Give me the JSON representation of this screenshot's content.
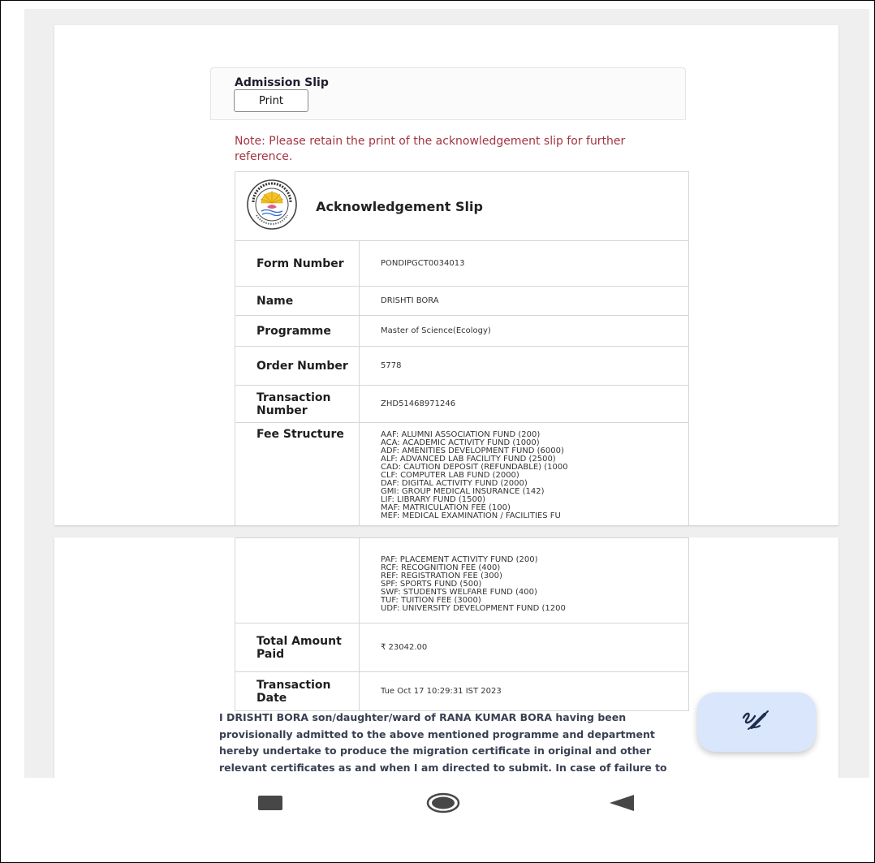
{
  "admission": {
    "title": "Admission Slip",
    "print_label": "Print"
  },
  "note": "Note: Please retain the print of the acknowledgement slip for further reference.",
  "slip": {
    "title": "Acknowledgement Slip",
    "logo_text": "PONDICHERRY UNIVERSITY",
    "rows": [
      {
        "label": "Form Number",
        "value": "PONDIPGCT0034013"
      },
      {
        "label": "Name",
        "value": "DRISHTI BORA"
      },
      {
        "label": "Programme",
        "value": "Master of Science(Ecology)"
      },
      {
        "label": "Order Number",
        "value": "5778"
      },
      {
        "label": "Transaction Number",
        "value": "ZHD51468971246"
      }
    ],
    "fee_label": "Fee Structure",
    "fees_page1": [
      "AAF: ALUMNI ASSOCIATION FUND (200)",
      "ACA: ACADEMIC ACTIVITY FUND (1000)",
      "ADF: AMENITIES DEVELOPMENT FUND (6000)",
      "ALF: ADVANCED LAB FACILITY FUND (2500)",
      "CAD: CAUTION DEPOSIT (REFUNDABLE) (1000",
      "CLF: COMPUTER LAB FUND (2000)",
      "DAF: DIGITAL ACTIVITY FUND (2000)",
      "GMI: GROUP MEDICAL INSURANCE (142)",
      "LIF: LIBRARY FUND (1500)",
      "MAF: MATRICULATION FEE (100)",
      "MEF: MEDICAL EXAMINATION / FACILITIES FU"
    ],
    "fees_page2": [
      "PAF: PLACEMENT ACTIVITY FUND (200)",
      "RCF: RECOGNITION FEE (400)",
      "REF: REGISTRATION FEE (300)",
      "SPF: SPORTS FUND (500)",
      "SWF: STUDENTS WELFARE FUND (400)",
      "TUF: TUITION FEE (3000)",
      "UDF: UNIVERSITY DEVELOPMENT FUND (1200"
    ],
    "total_label": "Total Amount Paid",
    "total_value": "₹ 23042.00",
    "date_label": "Transaction Date",
    "date_value": "Tue Oct 17 10:29:31 IST 2023"
  },
  "declaration": "I DRISHTI BORA son/daughter/ward of RANA KUMAR BORA having been provisionally admitted to the above mentioned programme and department hereby undertake to produce the migration certificate in original and other relevant certificates as and when I am directed to submit. In case of failure to produce the same, I",
  "fab_icon": "draw-icon",
  "colors": {
    "note": "#a23541",
    "fab_bg": "#d9e6fb",
    "viewer_bg": "#efefef"
  }
}
